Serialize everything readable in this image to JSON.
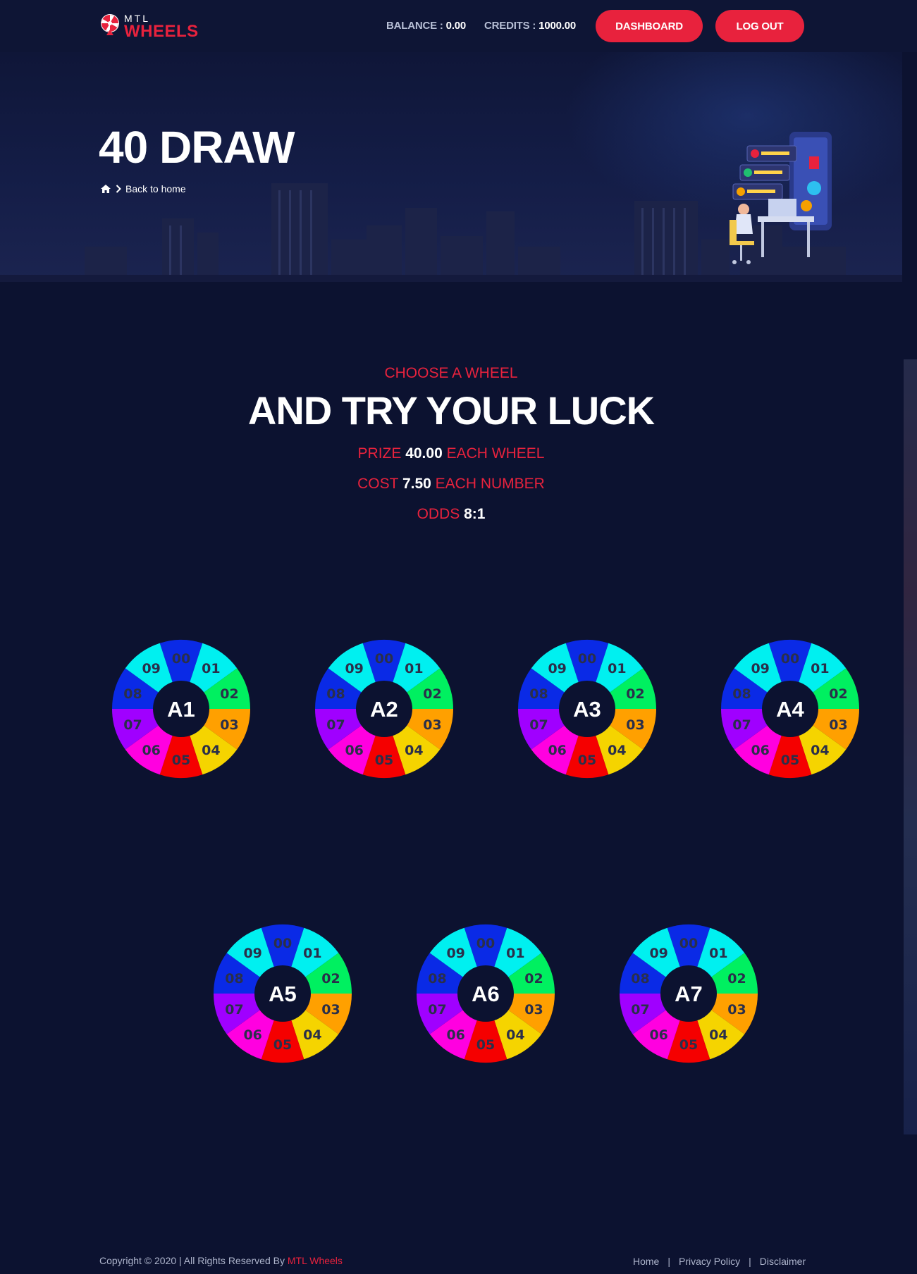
{
  "header": {
    "logo_top": "MTL",
    "logo_bottom": "WHEELS",
    "balance_label": "BALANCE : ",
    "balance_value": "0.00",
    "credits_label": "CREDITS : ",
    "credits_value": "1000.00",
    "dashboard_label": "DASHBOARD",
    "logout_label": "LOG OUT"
  },
  "hero": {
    "title": "40 DRAW",
    "breadcrumb_label": "Back to home",
    "icons": [
      "home-icon",
      "chevron-right-icon"
    ]
  },
  "intro": {
    "eyebrow": "CHOOSE A WHEEL",
    "headline": "AND TRY YOUR LUCK",
    "prize_label": "PRIZE ",
    "prize_value": "40.00",
    "prize_suffix": " EACH WHEEL",
    "cost_label": "COST ",
    "cost_value": "7.50",
    "cost_suffix": " EACH NUMBER",
    "odds_label": "ODDS ",
    "odds_value": "8:1"
  },
  "wheel_segments": [
    {
      "label": "00",
      "color": "#0a2ae6"
    },
    {
      "label": "01",
      "color": "#00f0f0"
    },
    {
      "label": "02",
      "color": "#00f060"
    },
    {
      "label": "03",
      "color": "#ffa000"
    },
    {
      "label": "04",
      "color": "#f5d400"
    },
    {
      "label": "05",
      "color": "#f50000"
    },
    {
      "label": "06",
      "color": "#ff00e0"
    },
    {
      "label": "07",
      "color": "#a000ff"
    },
    {
      "label": "08",
      "color": "#0a2ae6"
    },
    {
      "label": "09",
      "color": "#00f0f0"
    }
  ],
  "wheels": [
    {
      "name": "A1"
    },
    {
      "name": "A2"
    },
    {
      "name": "A3"
    },
    {
      "name": "A4"
    },
    {
      "name": "A5"
    },
    {
      "name": "A6"
    },
    {
      "name": "A7"
    }
  ],
  "footer": {
    "copyright": "Copyright © 2020 | All Rights Reserved By ",
    "brand": "MTL Wheels",
    "links": [
      "Home",
      "Privacy Policy",
      "Disclaimer"
    ]
  },
  "colors": {
    "accent": "#e8223d",
    "background": "#0c1230"
  }
}
